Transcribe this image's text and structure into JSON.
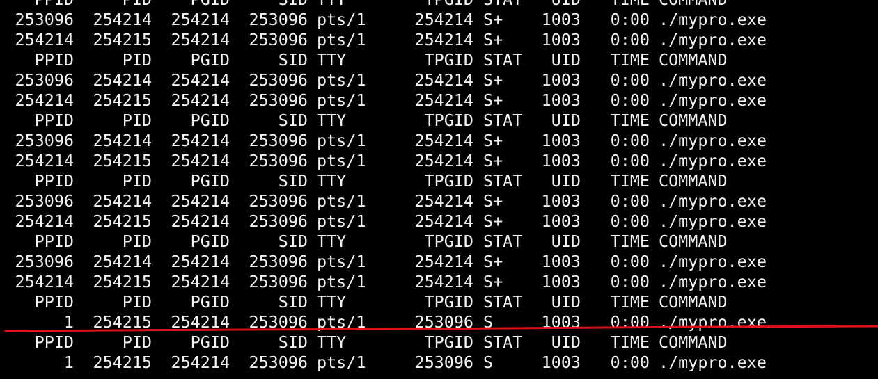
{
  "terminal": {
    "lines": [
      {
        "kind": "header",
        "ppid": "PPID",
        "pid": "PID",
        "pgid": "PGID",
        "sid": "SID",
        "tty": "TTY",
        "tpgid": "TPGID",
        "stat": "STAT",
        "uid": "UID",
        "time": "TIME",
        "command": "COMMAND"
      },
      {
        "kind": "row",
        "ppid": "253096",
        "pid": "254214",
        "pgid": "254214",
        "sid": "253096",
        "tty": "pts/1",
        "tpgid": "254214",
        "stat": "S+",
        "uid": "1003",
        "time": "0:00",
        "command": "./mypro.exe"
      },
      {
        "kind": "row",
        "ppid": "254214",
        "pid": "254215",
        "pgid": "254214",
        "sid": "253096",
        "tty": "pts/1",
        "tpgid": "254214",
        "stat": "S+",
        "uid": "1003",
        "time": "0:00",
        "command": "./mypro.exe"
      },
      {
        "kind": "header",
        "ppid": "PPID",
        "pid": "PID",
        "pgid": "PGID",
        "sid": "SID",
        "tty": "TTY",
        "tpgid": "TPGID",
        "stat": "STAT",
        "uid": "UID",
        "time": "TIME",
        "command": "COMMAND"
      },
      {
        "kind": "row",
        "ppid": "253096",
        "pid": "254214",
        "pgid": "254214",
        "sid": "253096",
        "tty": "pts/1",
        "tpgid": "254214",
        "stat": "S+",
        "uid": "1003",
        "time": "0:00",
        "command": "./mypro.exe"
      },
      {
        "kind": "row",
        "ppid": "254214",
        "pid": "254215",
        "pgid": "254214",
        "sid": "253096",
        "tty": "pts/1",
        "tpgid": "254214",
        "stat": "S+",
        "uid": "1003",
        "time": "0:00",
        "command": "./mypro.exe"
      },
      {
        "kind": "header",
        "ppid": "PPID",
        "pid": "PID",
        "pgid": "PGID",
        "sid": "SID",
        "tty": "TTY",
        "tpgid": "TPGID",
        "stat": "STAT",
        "uid": "UID",
        "time": "TIME",
        "command": "COMMAND"
      },
      {
        "kind": "row",
        "ppid": "253096",
        "pid": "254214",
        "pgid": "254214",
        "sid": "253096",
        "tty": "pts/1",
        "tpgid": "254214",
        "stat": "S+",
        "uid": "1003",
        "time": "0:00",
        "command": "./mypro.exe"
      },
      {
        "kind": "row",
        "ppid": "254214",
        "pid": "254215",
        "pgid": "254214",
        "sid": "253096",
        "tty": "pts/1",
        "tpgid": "254214",
        "stat": "S+",
        "uid": "1003",
        "time": "0:00",
        "command": "./mypro.exe"
      },
      {
        "kind": "header",
        "ppid": "PPID",
        "pid": "PID",
        "pgid": "PGID",
        "sid": "SID",
        "tty": "TTY",
        "tpgid": "TPGID",
        "stat": "STAT",
        "uid": "UID",
        "time": "TIME",
        "command": "COMMAND"
      },
      {
        "kind": "row",
        "ppid": "253096",
        "pid": "254214",
        "pgid": "254214",
        "sid": "253096",
        "tty": "pts/1",
        "tpgid": "254214",
        "stat": "S+",
        "uid": "1003",
        "time": "0:00",
        "command": "./mypro.exe"
      },
      {
        "kind": "row",
        "ppid": "254214",
        "pid": "254215",
        "pgid": "254214",
        "sid": "253096",
        "tty": "pts/1",
        "tpgid": "254214",
        "stat": "S+",
        "uid": "1003",
        "time": "0:00",
        "command": "./mypro.exe"
      },
      {
        "kind": "header",
        "ppid": "PPID",
        "pid": "PID",
        "pgid": "PGID",
        "sid": "SID",
        "tty": "TTY",
        "tpgid": "TPGID",
        "stat": "STAT",
        "uid": "UID",
        "time": "TIME",
        "command": "COMMAND"
      },
      {
        "kind": "row",
        "ppid": "253096",
        "pid": "254214",
        "pgid": "254214",
        "sid": "253096",
        "tty": "pts/1",
        "tpgid": "254214",
        "stat": "S+",
        "uid": "1003",
        "time": "0:00",
        "command": "./mypro.exe"
      },
      {
        "kind": "row",
        "ppid": "254214",
        "pid": "254215",
        "pgid": "254214",
        "sid": "253096",
        "tty": "pts/1",
        "tpgid": "254214",
        "stat": "S+",
        "uid": "1003",
        "time": "0:00",
        "command": "./mypro.exe"
      },
      {
        "kind": "header",
        "ppid": "PPID",
        "pid": "PID",
        "pgid": "PGID",
        "sid": "SID",
        "tty": "TTY",
        "tpgid": "TPGID",
        "stat": "STAT",
        "uid": "UID",
        "time": "TIME",
        "command": "COMMAND"
      },
      {
        "kind": "row",
        "ppid": "1",
        "pid": "254215",
        "pgid": "254214",
        "sid": "253096",
        "tty": "pts/1",
        "tpgid": "253096",
        "stat": "S",
        "uid": "1003",
        "time": "0:00",
        "command": "./mypro.exe"
      },
      {
        "kind": "header",
        "ppid": "PPID",
        "pid": "PID",
        "pgid": "PGID",
        "sid": "SID",
        "tty": "TTY",
        "tpgid": "TPGID",
        "stat": "STAT",
        "uid": "UID",
        "time": "TIME",
        "command": "COMMAND"
      },
      {
        "kind": "row",
        "ppid": "1",
        "pid": "254215",
        "pgid": "254214",
        "sid": "253096",
        "tty": "pts/1",
        "tpgid": "253096",
        "stat": "S",
        "uid": "1003",
        "time": "0:00",
        "command": "./mypro.exe"
      }
    ]
  },
  "colors": {
    "background": "#000000",
    "text": "#f2f2f2",
    "marker": "#e0101a"
  }
}
